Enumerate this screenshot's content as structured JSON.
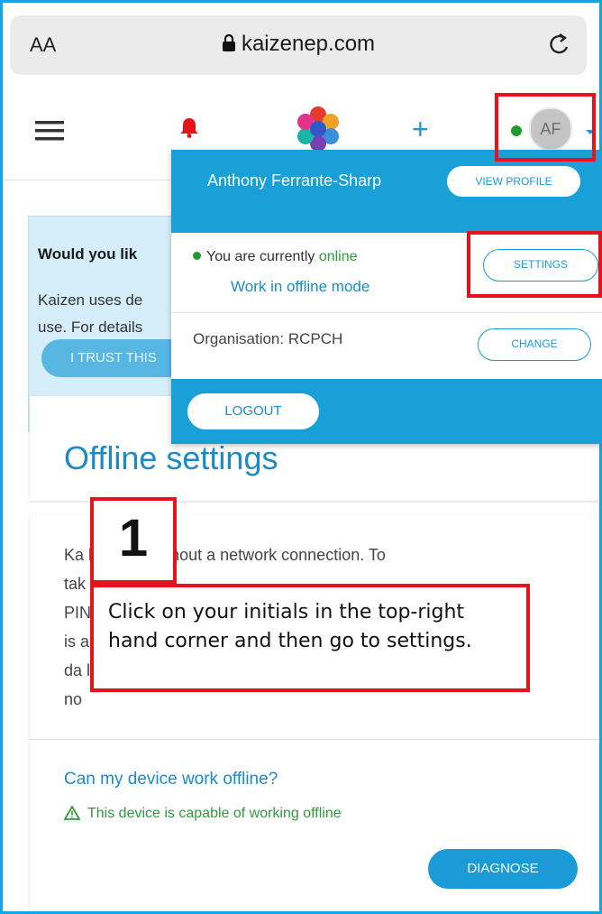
{
  "browser": {
    "text_size_label": "AA",
    "url": "kaizenep.com"
  },
  "dropdown": {
    "user_name": "Anthony Ferrante-Sharp",
    "view_profile_label": "VIEW PROFILE",
    "status_prefix": "You are currently ",
    "status_word": "online",
    "offline_link": "Work in offline mode",
    "settings_label": "SETTINGS",
    "organisation": "Organisation: RCPCH",
    "change_label": "CHANGE",
    "logout_label": "LOGOUT"
  },
  "navbar": {
    "avatar_initials": "AF",
    "plus_label": "+"
  },
  "cookie_banner": {
    "title_fragment": "Would you lik",
    "text_line1": "Kaizen uses de",
    "text_line2": "use. For details",
    "trust_button": "I TRUST THIS"
  },
  "offline": {
    "title": "Offline settings",
    "desc_lines": [
      "Ka           be used without a network connection. To",
      "tak",
      "PIN                                                      is",
      "is a",
      "da                                                        ll",
      "no"
    ],
    "device_question": "Can my device work offline?",
    "device_status": "This device is capable of working offline",
    "diagnose_label": "DIAGNOSE"
  },
  "annotation": {
    "step_number": "1",
    "instruction": "Click on your initials in the top-right hand corner and then go to settings."
  },
  "colors": {
    "accent": "#1a9bd7",
    "highlight": "#e8121c",
    "online": "#1f9a2e"
  }
}
